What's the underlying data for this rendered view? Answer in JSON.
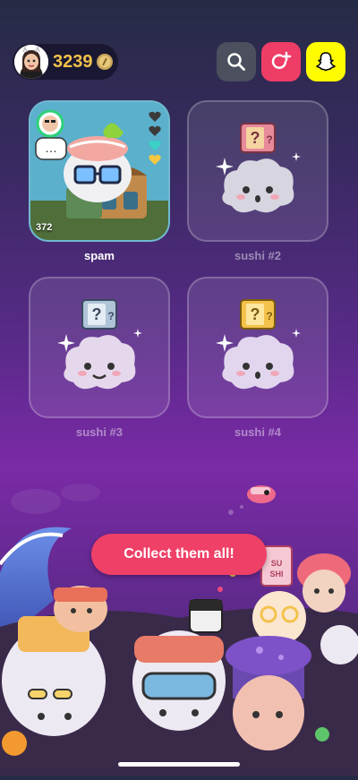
{
  "header": {
    "coins": "3239",
    "icons": [
      "avatar-icon",
      "coin-icon",
      "search-icon",
      "add-friend-icon",
      "snapchat-icon"
    ]
  },
  "cards": [
    {
      "label": "spam",
      "count": "372",
      "active": true
    },
    {
      "label": "sushi #2",
      "active": false
    },
    {
      "label": "sushi #3",
      "active": false
    },
    {
      "label": "sushi #4",
      "active": false
    }
  ],
  "hearts": [
    "#3b3b3b",
    "#3b3b3b",
    "#3ad1c6",
    "#f5c842"
  ],
  "cta_label": "Collect them all!",
  "colors": {
    "accent": "#ef4067",
    "snap_yellow": "#fffc00",
    "coin": "#f3c24a"
  }
}
